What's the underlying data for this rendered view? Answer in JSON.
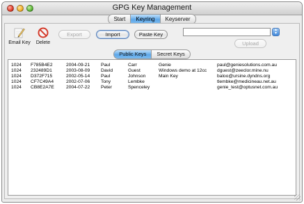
{
  "window": {
    "title": "GPG Key Management"
  },
  "tabs": [
    {
      "label": "Start",
      "active": false
    },
    {
      "label": "Keyring",
      "active": true
    },
    {
      "label": "Keyserver",
      "active": false
    }
  ],
  "toolbar": {
    "email_key": "Email Key",
    "delete": "Delete",
    "export": "Export",
    "import": "Import",
    "paste_key": "Paste Key",
    "upload": "Upload"
  },
  "search": {
    "value": "",
    "placeholder": ""
  },
  "subtabs": [
    {
      "label": "Public Keys",
      "active": true
    },
    {
      "label": "Secret Keys",
      "active": false
    }
  ],
  "keys": [
    [
      "1024",
      "F785B4E2",
      "2004-09-21",
      "Paul",
      "Carr",
      "Genie",
      "paul@geniesolutions.com.au"
    ],
    [
      "1024",
      "232489D1",
      "2003-08-09",
      "David",
      "Guest",
      "Windows demo at 12cc",
      "dguest@zeeclor.mine.nu"
    ],
    [
      "1024",
      "D372F715",
      "2002-05-14",
      "Paul",
      "Johnson",
      "Main Key",
      "baloo@ursine.dyndns.org"
    ],
    [
      "1024",
      "CF7C49A4",
      "2002-07-06",
      "Tony",
      "Lembke",
      "",
      "tlembke@medicineau.net.au"
    ],
    [
      "1024",
      "CB8E2A7E",
      "2004-07-22",
      "Peter",
      "Spenceley",
      "",
      "genie_test@optusnet.com.au"
    ]
  ],
  "colors": {
    "accent_blue": "#5ea7e8",
    "window_bg": "#ececec"
  }
}
